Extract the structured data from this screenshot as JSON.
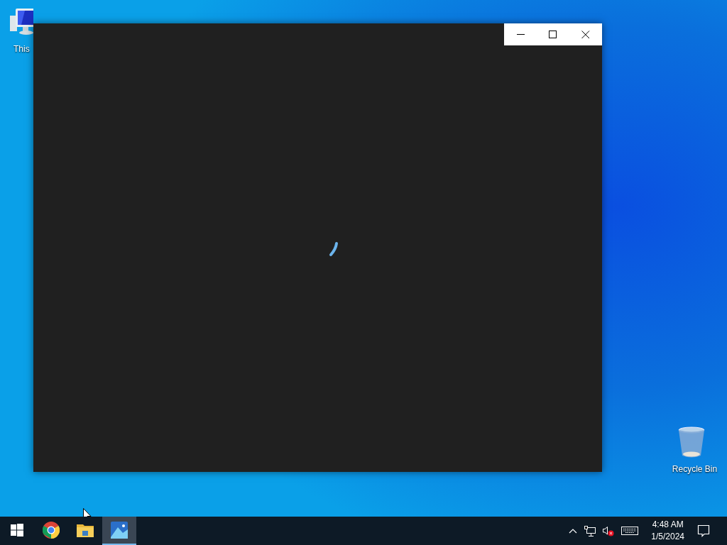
{
  "desktop_icons": [
    {
      "kind": "computer",
      "label": "This"
    },
    {
      "kind": "recycle-bin",
      "label": "Recycle Bin"
    }
  ],
  "window": {
    "loading": true
  },
  "taskbar": {
    "apps": [
      {
        "kind": "start",
        "selected": false
      },
      {
        "kind": "browser",
        "selected": false
      },
      {
        "kind": "folder",
        "selected": false
      },
      {
        "kind": "photos",
        "selected": true
      }
    ],
    "tray": {
      "time": "4:48 AM",
      "date": "1/5/2024",
      "sound_muted": true
    }
  }
}
